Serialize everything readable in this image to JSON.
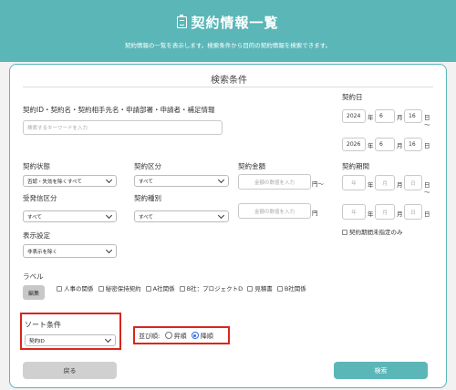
{
  "header": {
    "title": "契約情報一覧",
    "subtitle": "契約情報の一覧を表示します。検索条件から目的の契約情報を検索できます。"
  },
  "panel": {
    "title": "検索条件"
  },
  "keyword": {
    "label": "契約ID・契約名・契約相手先名・申請部署・申請者・補足情報",
    "placeholder": "検索するキーワードを入力"
  },
  "contract_date": {
    "label": "契約日",
    "from": {
      "year": "2024",
      "month": "6",
      "day": "16"
    },
    "to": {
      "year": "2026",
      "month": "6",
      "day": "16"
    },
    "unit_year": "年",
    "unit_month": "月",
    "unit_day": "日",
    "tilde": "〜"
  },
  "status": {
    "label": "契約状態",
    "value": "否認・失効を除くすべて"
  },
  "category": {
    "label": "契約区分",
    "value": "すべて"
  },
  "amount": {
    "label": "契約金額",
    "placeholder": "金額の数値を入力",
    "unit": "円",
    "tilde": "〜"
  },
  "period": {
    "label": "契約期間",
    "ph_year": "年",
    "ph_month": "月",
    "ph_day": "日",
    "unspecified_label": "契約期間未指定のみ"
  },
  "direction": {
    "label": "受発信区分",
    "value": "すべて"
  },
  "type": {
    "label": "契約種別",
    "value": "すべて"
  },
  "display": {
    "label": "表示設定",
    "value": "非表示を除く"
  },
  "label_section": {
    "label": "ラベル",
    "edit_button": "編集",
    "items": [
      "人事の関係",
      "秘密保持契約",
      "A社関係",
      "B社：プロジェクトD",
      "見積書",
      "B社関係"
    ]
  },
  "sort": {
    "label": "ソート条件",
    "value": "契約ID"
  },
  "order": {
    "label": "並び順:",
    "asc": "昇順",
    "desc": "降順",
    "selected": "desc"
  },
  "buttons": {
    "back": "戻る",
    "search": "検索"
  },
  "colors": {
    "teal": "#5bb6b8",
    "highlight_red": "#d9261c",
    "radio_blue": "#2f6fe0"
  }
}
